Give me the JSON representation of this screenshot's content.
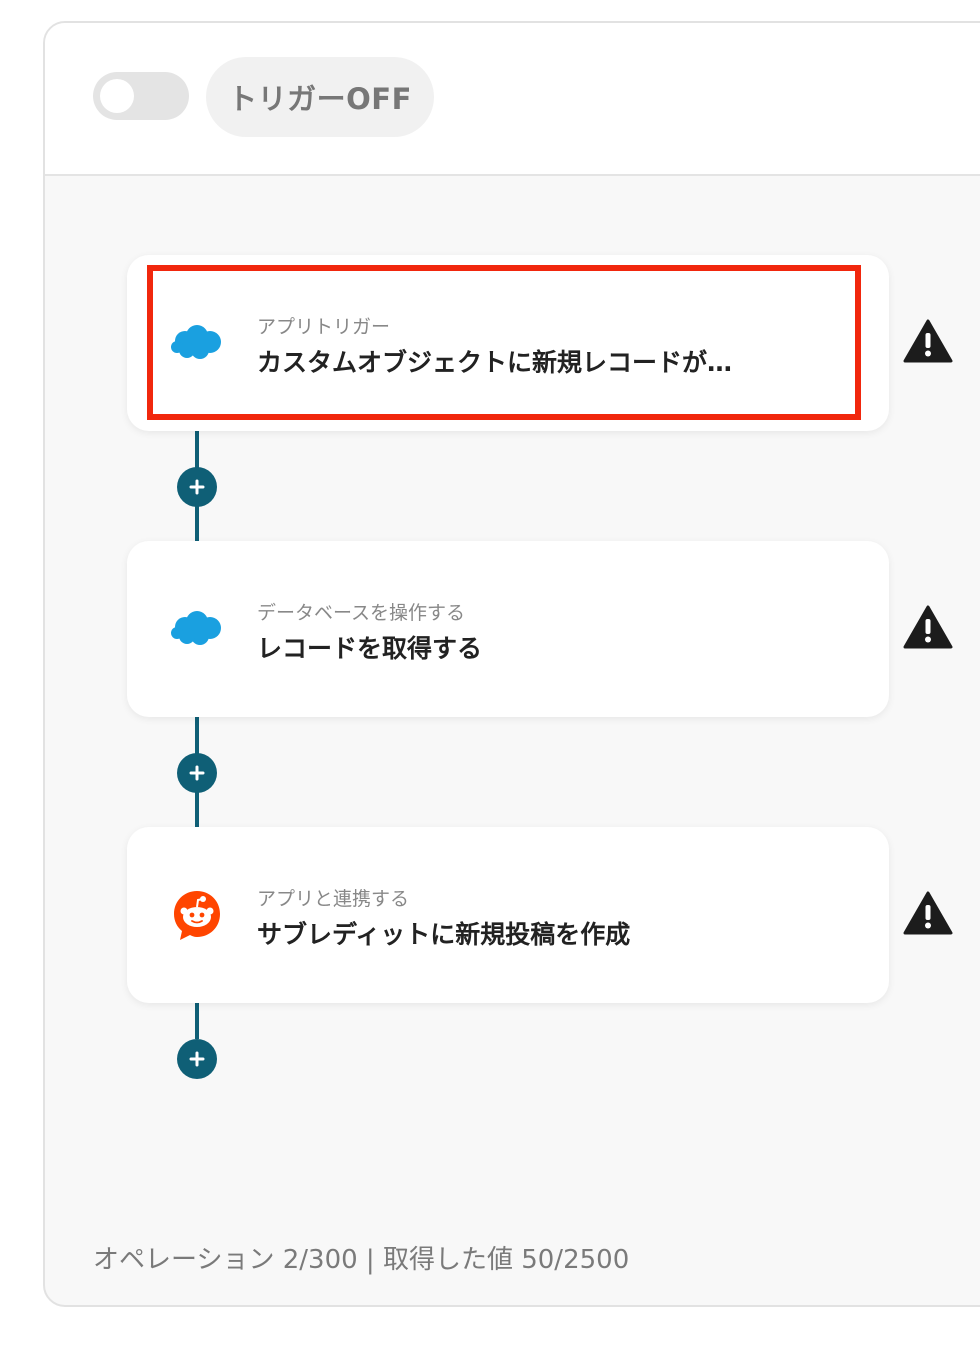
{
  "header": {
    "toggle_state": "off",
    "trigger_label": "トリガーOFF"
  },
  "steps": [
    {
      "app": "Salesforce",
      "icon": "salesforce-icon",
      "subtitle": "アプリトリガー",
      "title": "カスタムオブジェクトに新規レコードが…",
      "highlighted": true,
      "warning": true
    },
    {
      "app": "Salesforce",
      "icon": "salesforce-icon",
      "subtitle": "データベースを操作する",
      "title": "レコードを取得する",
      "highlighted": false,
      "warning": true
    },
    {
      "app": "Reddit",
      "icon": "reddit-icon",
      "subtitle": "アプリと連携する",
      "title": "サブレディットに新規投稿を作成",
      "highlighted": false,
      "warning": true
    }
  ],
  "footer": {
    "text": "オペレーション 2/300 | 取得した値 50/2500"
  },
  "colors": {
    "accent": "#0f5f76",
    "highlight": "#f1270d",
    "salesforce": "#1aa0e0",
    "reddit": "#ff4500"
  }
}
